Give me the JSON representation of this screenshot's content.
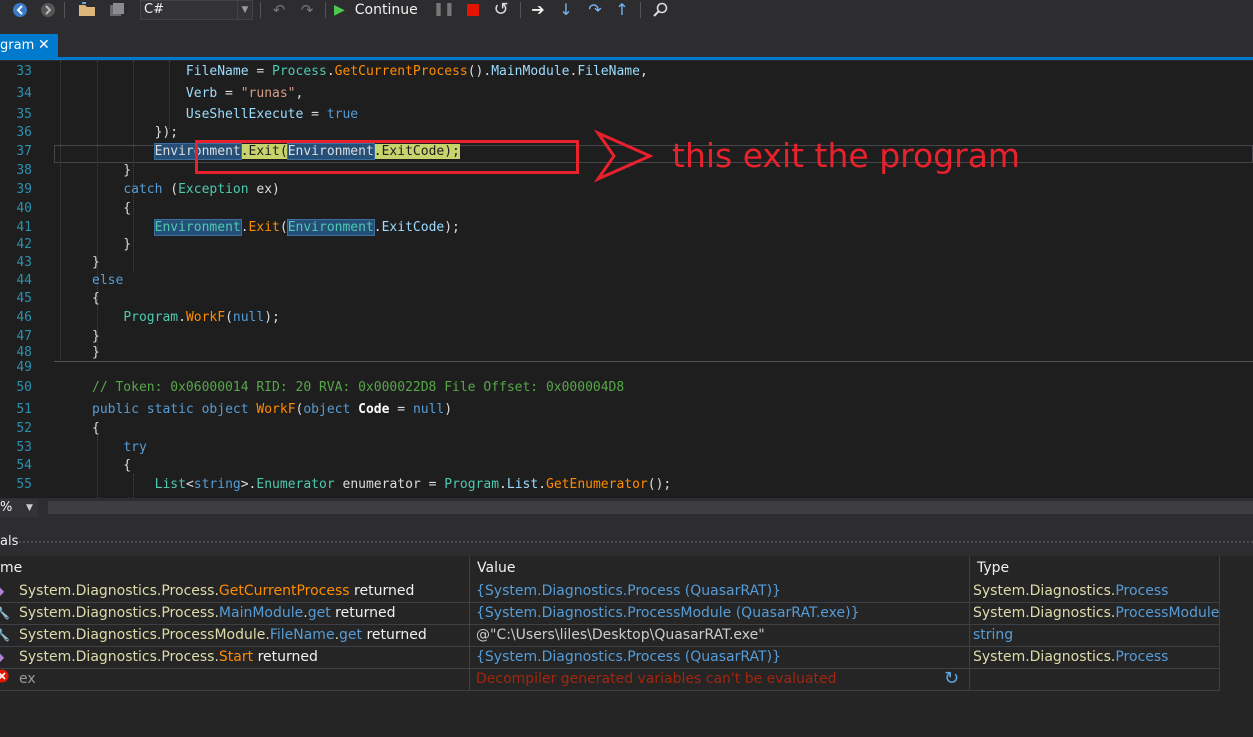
{
  "toolbar": {
    "language": "C#",
    "continue_label": "Continue"
  },
  "tab": {
    "title": "gram",
    "close": "✕"
  },
  "editor": {
    "lines": [
      {
        "n": "33",
        "tokens": [
          {
            "t": "            ",
            "c": ""
          },
          {
            "t": "FileName",
            "c": "p"
          },
          {
            "t": " = ",
            "c": ""
          },
          {
            "t": "Process",
            "c": "ty"
          },
          {
            "t": ".",
            "c": ""
          },
          {
            "t": "GetCurrentProcess",
            "c": "mt"
          },
          {
            "t": "().",
            "c": ""
          },
          {
            "t": "MainModule",
            "c": "pr"
          },
          {
            "t": ".",
            "c": ""
          },
          {
            "t": "FileName",
            "c": "pr"
          },
          {
            "t": ",",
            "c": ""
          }
        ]
      },
      {
        "n": "34",
        "tokens": [
          {
            "t": "            ",
            "c": ""
          },
          {
            "t": "Verb",
            "c": "p"
          },
          {
            "t": " = ",
            "c": ""
          },
          {
            "t": "\"runas\"",
            "c": "s"
          },
          {
            "t": ",",
            "c": ""
          }
        ]
      },
      {
        "n": "35",
        "tokens": [
          {
            "t": "            ",
            "c": ""
          },
          {
            "t": "UseShellExecute",
            "c": "p"
          },
          {
            "t": " = ",
            "c": ""
          },
          {
            "t": "true",
            "c": "k"
          }
        ]
      },
      {
        "n": "36",
        "tokens": [
          {
            "t": "        });",
            "c": ""
          }
        ]
      },
      {
        "n": "37",
        "tokens": [
          {
            "t": "        ",
            "c": ""
          },
          {
            "t": "Environment",
            "c": "hl1"
          },
          {
            "t": ".Exit(",
            "c": "hl2"
          },
          {
            "t": "Environment",
            "c": "hl1"
          },
          {
            "t": ".ExitCode);",
            "c": "hl2"
          }
        ]
      },
      {
        "n": "38",
        "tokens": [
          {
            "t": "    }",
            "c": ""
          }
        ]
      },
      {
        "n": "39",
        "tokens": [
          {
            "t": "    ",
            "c": ""
          },
          {
            "t": "catch",
            "c": "k"
          },
          {
            "t": " (",
            "c": ""
          },
          {
            "t": "Exception",
            "c": "ty"
          },
          {
            "t": " ex)",
            "c": ""
          }
        ]
      },
      {
        "n": "40",
        "tokens": [
          {
            "t": "    {",
            "c": ""
          }
        ]
      },
      {
        "n": "41",
        "tokens": [
          {
            "t": "        ",
            "c": ""
          },
          {
            "t": "Environment",
            "c": "hl1t"
          },
          {
            "t": ".",
            "c": ""
          },
          {
            "t": "Exit",
            "c": "mt"
          },
          {
            "t": "(",
            "c": ""
          },
          {
            "t": "Environment",
            "c": "hl1t"
          },
          {
            "t": ".",
            "c": ""
          },
          {
            "t": "ExitCode",
            "c": "pr"
          },
          {
            "t": ");",
            "c": ""
          }
        ]
      },
      {
        "n": "42",
        "tokens": [
          {
            "t": "    }",
            "c": ""
          }
        ]
      },
      {
        "n": "43",
        "tokens": [
          {
            "t": "}",
            "c": ""
          }
        ]
      },
      {
        "n": "44",
        "tokens": [
          {
            "t": "else",
            "c": "k"
          }
        ]
      },
      {
        "n": "45",
        "tokens": [
          {
            "t": "{",
            "c": ""
          }
        ]
      },
      {
        "n": "46",
        "tokens": [
          {
            "t": "    ",
            "c": ""
          },
          {
            "t": "Program",
            "c": "ty"
          },
          {
            "t": ".",
            "c": ""
          },
          {
            "t": "WorkF",
            "c": "mt"
          },
          {
            "t": "(",
            "c": ""
          },
          {
            "t": "null",
            "c": "k"
          },
          {
            "t": ");",
            "c": ""
          }
        ]
      },
      {
        "n": "47",
        "tokens": [
          {
            "t": "}",
            "c": ""
          }
        ]
      },
      {
        "n": "48",
        "tokens": [
          {
            "t": "}",
            "c": ""
          }
        ]
      },
      {
        "n": "49",
        "tokens": []
      },
      {
        "n": "50",
        "tokens": [
          {
            "t": "// Token: 0x06000014 RID: 20 RVA: 0x000022D8 File Offset: 0x000004D8",
            "c": "c"
          }
        ]
      },
      {
        "n": "51",
        "tokens": [
          {
            "t": "public",
            "c": "k"
          },
          {
            "t": " ",
            "c": ""
          },
          {
            "t": "static",
            "c": "k"
          },
          {
            "t": " ",
            "c": ""
          },
          {
            "t": "object",
            "c": "k"
          },
          {
            "t": " ",
            "c": ""
          },
          {
            "t": "WorkF",
            "c": "mt"
          },
          {
            "t": "(",
            "c": ""
          },
          {
            "t": "object",
            "c": "k"
          },
          {
            "t": " ",
            "c": ""
          },
          {
            "t": "Code",
            "c": "bl"
          },
          {
            "t": " = ",
            "c": ""
          },
          {
            "t": "null",
            "c": "k"
          },
          {
            "t": ")",
            "c": ""
          }
        ]
      },
      {
        "n": "52",
        "tokens": [
          {
            "t": "{",
            "c": ""
          }
        ]
      },
      {
        "n": "53",
        "tokens": [
          {
            "t": "    ",
            "c": ""
          },
          {
            "t": "try",
            "c": "k"
          }
        ]
      },
      {
        "n": "54",
        "tokens": [
          {
            "t": "    {",
            "c": ""
          }
        ]
      },
      {
        "n": "55",
        "tokens": [
          {
            "t": "        ",
            "c": ""
          },
          {
            "t": "List",
            "c": "ty"
          },
          {
            "t": "<",
            "c": ""
          },
          {
            "t": "string",
            "c": "k"
          },
          {
            "t": ">.",
            "c": ""
          },
          {
            "t": "Enumerator",
            "c": "ty"
          },
          {
            "t": " enumerator = ",
            "c": ""
          },
          {
            "t": "Program",
            "c": "ty"
          },
          {
            "t": ".",
            "c": ""
          },
          {
            "t": "List",
            "c": "pr"
          },
          {
            "t": ".",
            "c": ""
          },
          {
            "t": "GetEnumerator",
            "c": "mt"
          },
          {
            "t": "();",
            "c": ""
          }
        ]
      }
    ]
  },
  "annotation": {
    "text": "this exit the program"
  },
  "zoom": "%",
  "panel": {
    "title": "als"
  },
  "locals": {
    "headers": {
      "name": "me",
      "value": "Value",
      "type": "Type"
    },
    "rows": [
      {
        "icon": "method-icon",
        "name": [
          {
            "t": "System.Diagnostics.",
            "c": "ns"
          },
          {
            "t": "Process",
            "c": "ns"
          },
          {
            "t": ".",
            "c": "ns"
          },
          {
            "t": "GetCurrentProcess",
            "c": "mm"
          },
          {
            "t": " returned",
            "c": "plain"
          }
        ],
        "value": "{System.Diagnostics.Process (QuasarRAT)}",
        "vclass": "vb",
        "type": [
          {
            "t": "System.Diagnostics.",
            "c": "tyy"
          },
          {
            "t": "Process",
            "c": "tys"
          }
        ]
      },
      {
        "icon": "wrench-icon",
        "name": [
          {
            "t": "System.Diagnostics.",
            "c": "ns"
          },
          {
            "t": "Process",
            "c": "ns"
          },
          {
            "t": ".",
            "c": "ns"
          },
          {
            "t": "MainModule",
            "c": "vb"
          },
          {
            "t": ".",
            "c": "ns"
          },
          {
            "t": "get",
            "c": "vb"
          },
          {
            "t": " returned",
            "c": "plain"
          }
        ],
        "value": "{System.Diagnostics.ProcessModule (QuasarRAT.exe)}",
        "vclass": "vb",
        "type": [
          {
            "t": "System.Diagnostics.",
            "c": "tyy"
          },
          {
            "t": "ProcessModule",
            "c": "tys"
          }
        ]
      },
      {
        "icon": "wrench-icon",
        "name": [
          {
            "t": "System.Diagnostics.",
            "c": "ns"
          },
          {
            "t": "ProcessModule",
            "c": "ns"
          },
          {
            "t": ".",
            "c": "ns"
          },
          {
            "t": "FileName",
            "c": "vb"
          },
          {
            "t": ".",
            "c": "ns"
          },
          {
            "t": "get",
            "c": "vb"
          },
          {
            "t": " returned",
            "c": "plain"
          }
        ],
        "value": "@\"C:\\Users\\liles\\Desktop\\QuasarRAT.exe\"",
        "vclass": "vs",
        "type": [
          {
            "t": "string",
            "c": "tys"
          }
        ]
      },
      {
        "icon": "method-icon",
        "name": [
          {
            "t": "System.Diagnostics.",
            "c": "ns"
          },
          {
            "t": "Process",
            "c": "ns"
          },
          {
            "t": ".",
            "c": "ns"
          },
          {
            "t": "Start",
            "c": "mm"
          },
          {
            "t": " returned",
            "c": "plain"
          }
        ],
        "value": "{System.Diagnostics.Process (QuasarRAT)}",
        "vclass": "vb",
        "type": [
          {
            "t": "System.Diagnostics.",
            "c": "tyy"
          },
          {
            "t": "Process",
            "c": "tys"
          }
        ]
      },
      {
        "icon": "error-icon",
        "name": [
          {
            "t": "ex",
            "c": "plaingray"
          }
        ],
        "value": "Decompiler generated variables can't be evaluated",
        "vclass": "err",
        "type": []
      }
    ]
  }
}
